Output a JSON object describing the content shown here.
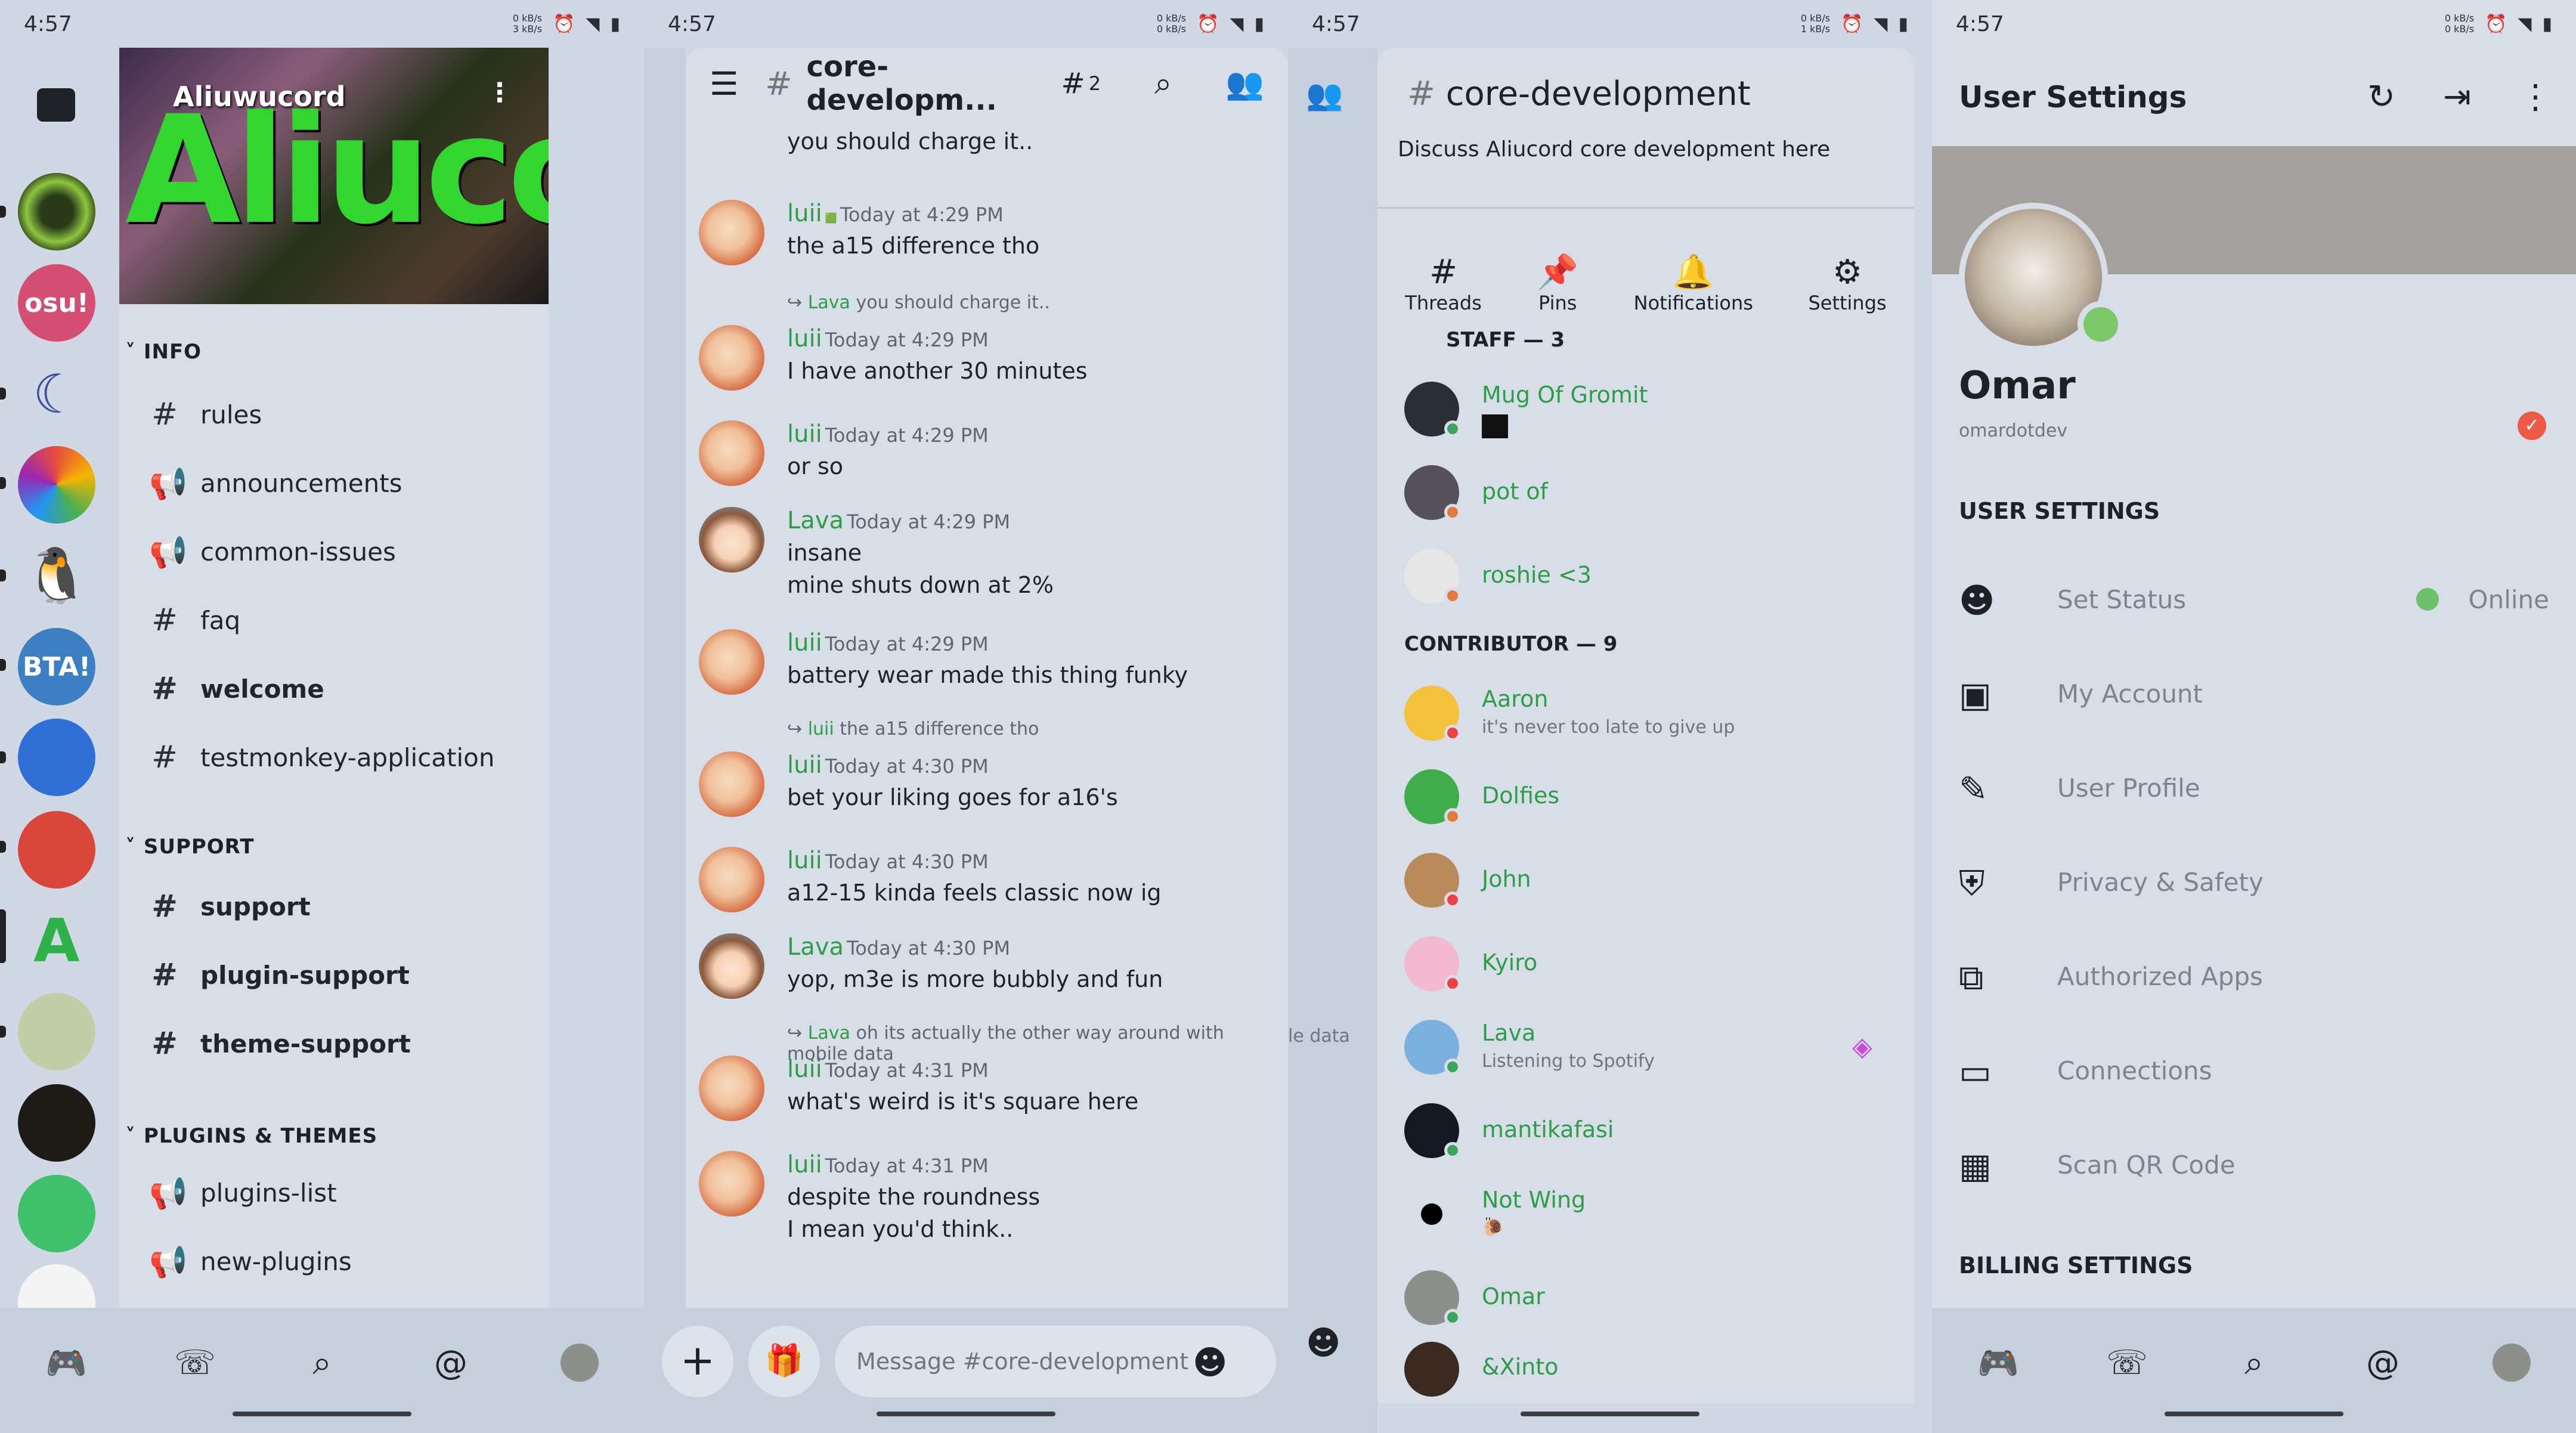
{
  "status_bar": {
    "time": "4:57",
    "kb1": "0 kB/s",
    "kb2": "3 kB/s",
    "kb3": "0 kB/s",
    "kb4": "0 kB/s",
    "kb5": "0 kB/s",
    "kb6": "1 kB/s",
    "kb7": "0 kB/s",
    "kb8": "0 kB/s"
  },
  "panel1": {
    "server_name": "Aliuwucord",
    "banner_text": "Aliucord",
    "categories": [
      {
        "label": "INFO"
      },
      {
        "label": "SUPPORT"
      },
      {
        "label": "PLUGINS & THEMES"
      }
    ],
    "channels": [
      "rules",
      "announcements",
      "common-issues",
      "faq",
      "welcome",
      "testmonkey-application",
      "support",
      "plugin-support",
      "theme-support",
      "plugins-list",
      "new-plugins"
    ],
    "server_badge": "osu!"
  },
  "panel2": {
    "channel": "core-developm...",
    "threads_count": "2",
    "input_placeholder": "Message #core-development",
    "messages": [
      {
        "text": "you should charge it.."
      },
      {
        "author": "luii",
        "time": "Today at 4:29 PM",
        "text": "the a15 difference tho"
      },
      {
        "reply_author": "Lava",
        "reply_text": "you should charge it..",
        "author": "luii",
        "time": "Today at 4:29 PM",
        "text": "I have another 30 minutes"
      },
      {
        "author": "luii",
        "time": "Today at 4:29 PM",
        "text": "or so"
      },
      {
        "author": "Lava",
        "time": "Today at 4:29 PM",
        "text": "insane",
        "text2": "mine shuts down at 2%"
      },
      {
        "author": "luii",
        "time": "Today at 4:29 PM",
        "text": "battery wear made this thing funky"
      },
      {
        "reply_author": "luii",
        "reply_text": "the a15 difference tho",
        "author": "luii",
        "time": "Today at 4:30 PM",
        "text": "bet your liking goes for a16's"
      },
      {
        "author": "luii",
        "time": "Today at 4:30 PM",
        "text": "a12-15 kinda feels classic now ig"
      },
      {
        "author": "Lava",
        "time": "Today at 4:30 PM",
        "text": "yop, m3e is more bubbly and fun"
      },
      {
        "reply_author": "Lava",
        "reply_text": "oh its actually the other way around with mobile data",
        "author": "luii",
        "time": "Today at 4:31 PM",
        "text": "what's weird is it's square here"
      },
      {
        "author": "luii",
        "time": "Today at 4:31 PM",
        "text": "despite the roundness",
        "text2": "I mean you'd think.."
      }
    ],
    "peek_text": "le data"
  },
  "panel3": {
    "channel": "core-development",
    "topic": "Discuss Aliucord core development here",
    "actions": [
      "Threads",
      "Pins",
      "Notifications",
      "Settings"
    ],
    "staff_header": "STAFF — 3",
    "contrib_header": "CONTRIBUTOR — 9",
    "staff": [
      {
        "name": "Mug Of Gromit"
      },
      {
        "name": "pot of"
      },
      {
        "name": "roshie <3"
      }
    ],
    "contributors": [
      {
        "name": "Aaron",
        "sub": "it's never too late to give up"
      },
      {
        "name": "Dolfies"
      },
      {
        "name": "John"
      },
      {
        "name": "Kyiro"
      },
      {
        "name": "Lava",
        "sub": "Listening to Spotify"
      },
      {
        "name": "mantikafasi"
      },
      {
        "name": "Not Wing"
      },
      {
        "name": "Omar"
      },
      {
        "name": "&Xinto"
      }
    ]
  },
  "panel4": {
    "title": "User Settings",
    "display_name": "Omar",
    "username": "omardotdev",
    "section": "USER SETTINGS",
    "rows": [
      "Set Status",
      "My Account",
      "User Profile",
      "Privacy & Safety",
      "Authorized Apps",
      "Connections",
      "Scan QR Code"
    ],
    "status_value": "Online",
    "billing": "BILLING SETTINGS"
  },
  "colors": {
    "accent_green": "#2e9d48",
    "panel_bg": "#d7dee8",
    "bar_bg": "#c6d0dc"
  }
}
